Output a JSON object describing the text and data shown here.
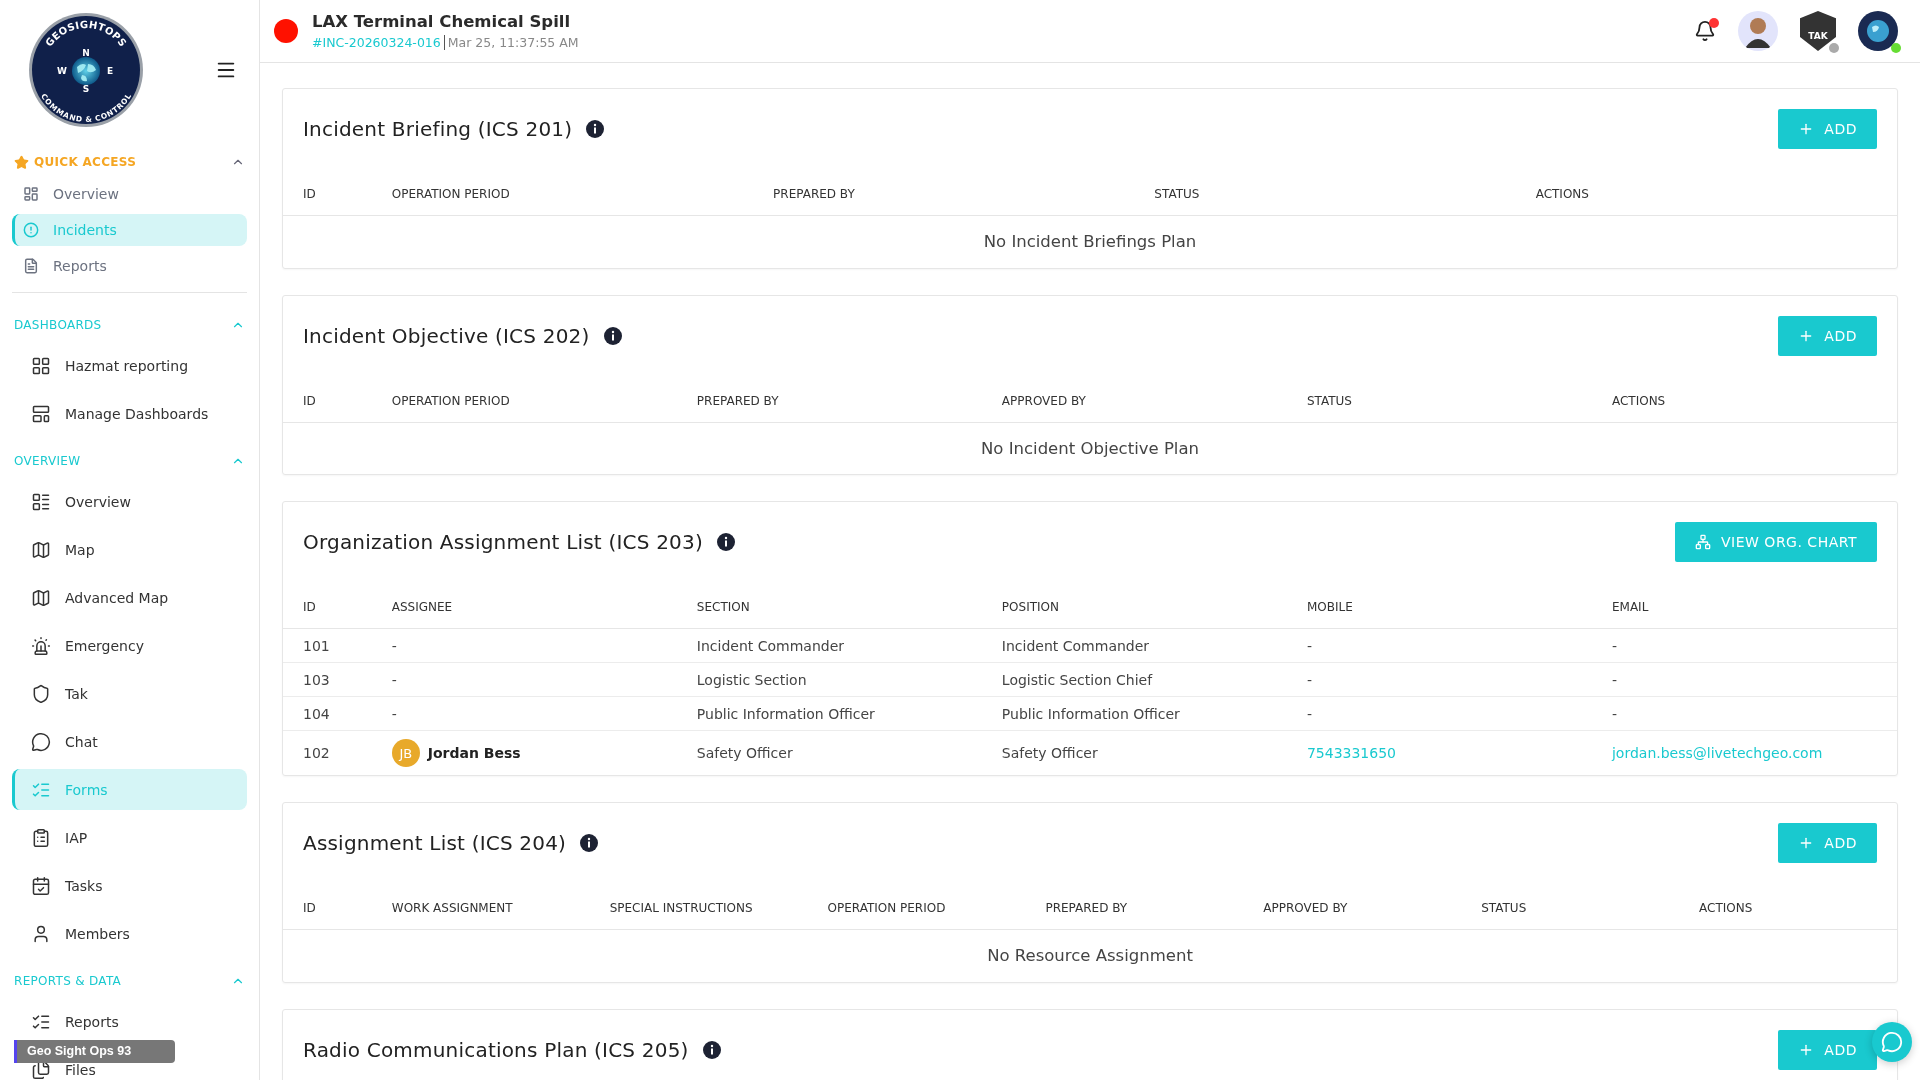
{
  "sidebar": {
    "logo": {
      "name": "GEOSIGHTOPS",
      "tagline": "COMMAND & CONTROL",
      "compass": [
        "N",
        "E",
        "S",
        "W"
      ]
    },
    "sections": [
      {
        "title": "QUICK ACCESS",
        "kind": "quick",
        "expanded": true,
        "items": [
          {
            "label": "Overview",
            "selected": false
          },
          {
            "label": "Incidents",
            "selected": true
          },
          {
            "label": "Reports",
            "selected": false
          }
        ]
      },
      {
        "title": "DASHBOARDS",
        "kind": "group",
        "expanded": true,
        "items": [
          {
            "label": "Hazmat reporting",
            "selected": false
          },
          {
            "label": "Manage Dashboards",
            "selected": false
          }
        ]
      },
      {
        "title": "OVERVIEW",
        "kind": "group",
        "expanded": true,
        "items": [
          {
            "label": "Overview",
            "selected": false
          },
          {
            "label": "Map",
            "selected": false
          },
          {
            "label": "Advanced Map",
            "selected": false
          },
          {
            "label": "Emergency",
            "selected": false
          },
          {
            "label": "Tak",
            "selected": false
          },
          {
            "label": "Chat",
            "selected": false
          },
          {
            "label": "Forms",
            "selected": true
          },
          {
            "label": "IAP",
            "selected": false
          },
          {
            "label": "Tasks",
            "selected": false
          },
          {
            "label": "Members",
            "selected": false
          }
        ]
      },
      {
        "title": "REPORTS & DATA",
        "kind": "group",
        "expanded": true,
        "items": [
          {
            "label": "Reports",
            "selected": false
          },
          {
            "label": "Files",
            "selected": false
          }
        ]
      }
    ],
    "tooltip": "Geo Sight Ops 93"
  },
  "header": {
    "title": "LAX Terminal Chemical Spill",
    "incident_id": "#INC-20260324-016",
    "timestamp": "Mar 25, 11:37:55 AM",
    "unread_notifications": true,
    "tak_badge": "TAK",
    "tak_online": false,
    "org_online": true
  },
  "cards": [
    {
      "title": "Incident Briefing (ICS 201)",
      "action": {
        "kind": "add",
        "label": "ADD"
      },
      "columns": [
        "ID",
        "OPERATION PERIOD",
        "PREPARED BY",
        "STATUS",
        "ACTIONS"
      ],
      "empty_message": "No Incident Briefings Plan"
    },
    {
      "title": "Incident Objective (ICS 202)",
      "action": {
        "kind": "add",
        "label": "ADD"
      },
      "columns": [
        "ID",
        "OPERATION PERIOD",
        "PREPARED BY",
        "APPROVED BY",
        "STATUS",
        "ACTIONS"
      ],
      "empty_message": "No Incident Objective Plan"
    },
    {
      "title": "Organization Assignment List (ICS 203)",
      "action": {
        "kind": "org_chart",
        "label": "VIEW ORG. CHART"
      },
      "columns": [
        "ID",
        "ASSIGNEE",
        "SECTION",
        "POSITION",
        "MOBILE",
        "EMAIL"
      ],
      "rows": [
        {
          "id": "101",
          "assignee": "-",
          "section": "Incident Commander",
          "position": "Incident Commander",
          "mobile": "-",
          "email": "-",
          "linked": false
        },
        {
          "id": "103",
          "assignee": "-",
          "section": "Logistic Section",
          "position": "Logistic Section Chief",
          "mobile": "-",
          "email": "-",
          "linked": false
        },
        {
          "id": "104",
          "assignee": "-",
          "section": "Public Information Officer",
          "position": "Public Information Officer",
          "mobile": "-",
          "email": "-",
          "linked": false
        },
        {
          "id": "102",
          "assignee": "Jordan Bess",
          "initials": "JB",
          "section": "Safety Officer",
          "position": "Safety Officer",
          "mobile": "7543331650",
          "email": "jordan.bess@livetechgeo.com",
          "linked": true
        }
      ]
    },
    {
      "title": "Assignment List (ICS 204)",
      "action": {
        "kind": "add",
        "label": "ADD"
      },
      "columns": [
        "ID",
        "WORK ASSIGNMENT",
        "SPECIAL INSTRUCTIONS",
        "OPERATION PERIOD",
        "PREPARED BY",
        "APPROVED BY",
        "STATUS",
        "ACTIONS"
      ],
      "empty_message": "No Resource Assignment"
    },
    {
      "title": "Radio Communications Plan (ICS 205)",
      "action": {
        "kind": "add",
        "label": "ADD"
      }
    }
  ]
}
